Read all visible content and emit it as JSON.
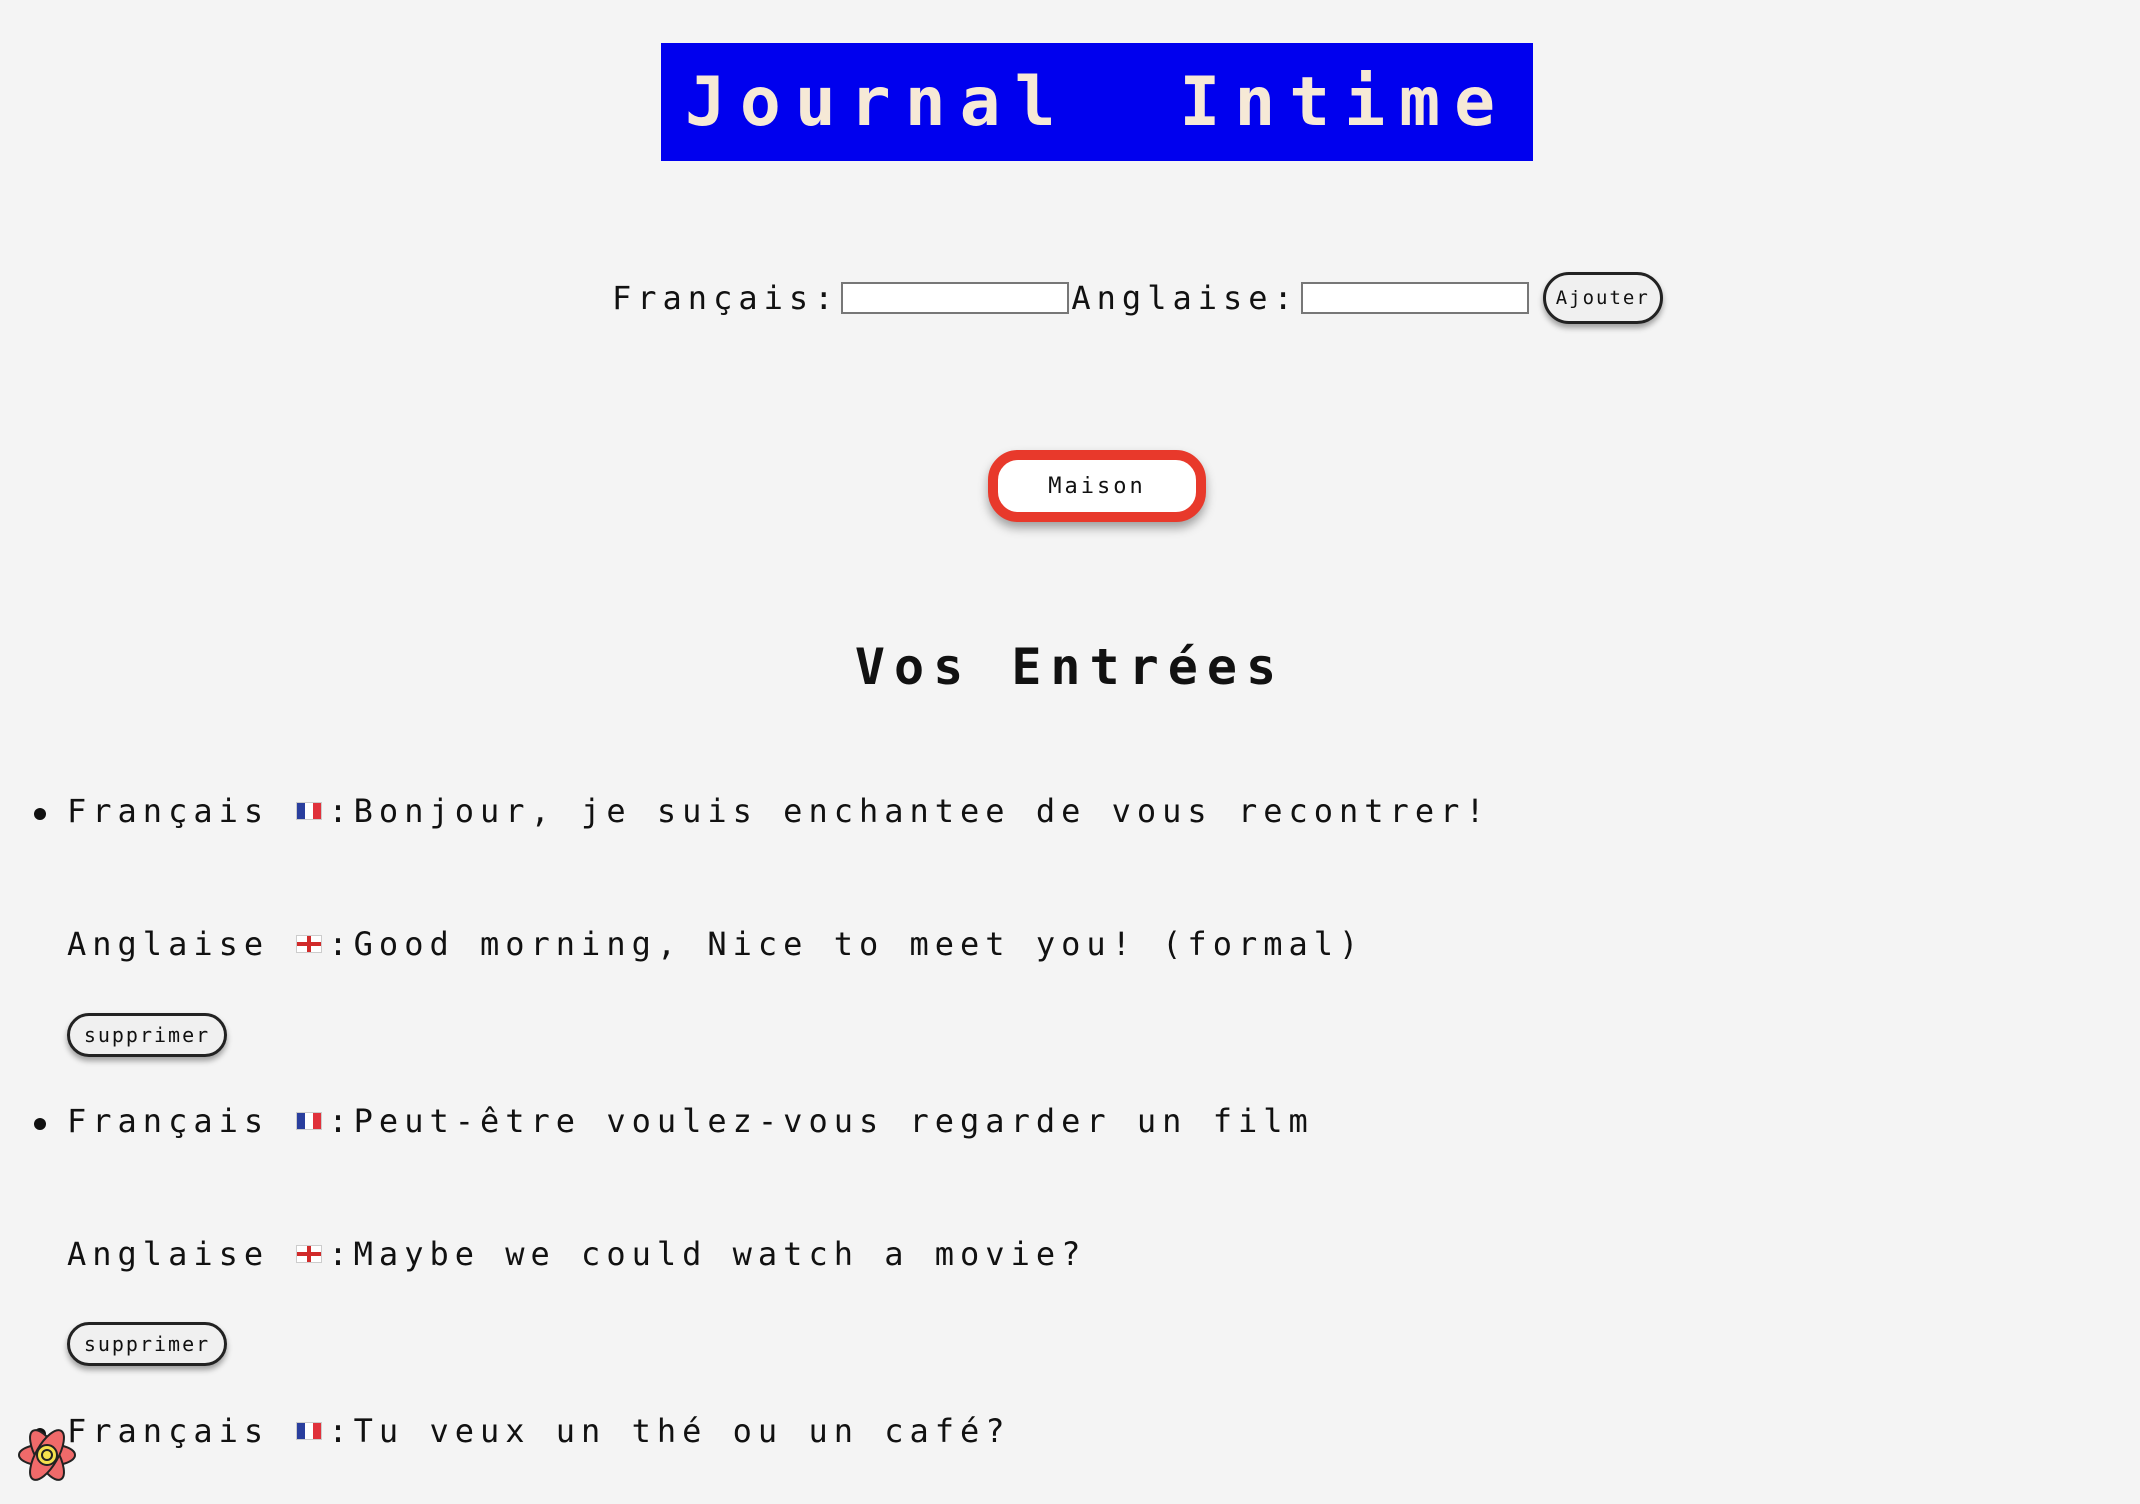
{
  "header": {
    "title": "Journal  Intime"
  },
  "form": {
    "french_label": "Français:",
    "english_label": "Anglaise:",
    "french_value": "",
    "english_value": "",
    "add_label": "Ajouter"
  },
  "nav": {
    "home_label": "Maison"
  },
  "entries_section": {
    "title": "Vos Entrées",
    "french_prefix": "Français ",
    "english_prefix": "Anglaise ",
    "delete_label": "supprimer",
    "items": [
      {
        "french": ":Bonjour, je suis enchantee de vous recontrer!",
        "english": ":Good morning, Nice to meet you! (formal)"
      },
      {
        "french": ":Peut-être voulez-vous regarder un film",
        "english": ":Maybe we could watch a movie?"
      },
      {
        "french": ":Tu veux un thé ou un café?"
      }
    ]
  },
  "icons": {
    "french_flag": "flag-fr-icon",
    "english_flag": "flag-england-icon",
    "devtools": "react-devtools-icon"
  },
  "colors": {
    "title_bg": "#0000ee",
    "title_fg": "#f6e9d6",
    "home_border": "#e8392b",
    "page_bg": "#f4f4f4"
  }
}
